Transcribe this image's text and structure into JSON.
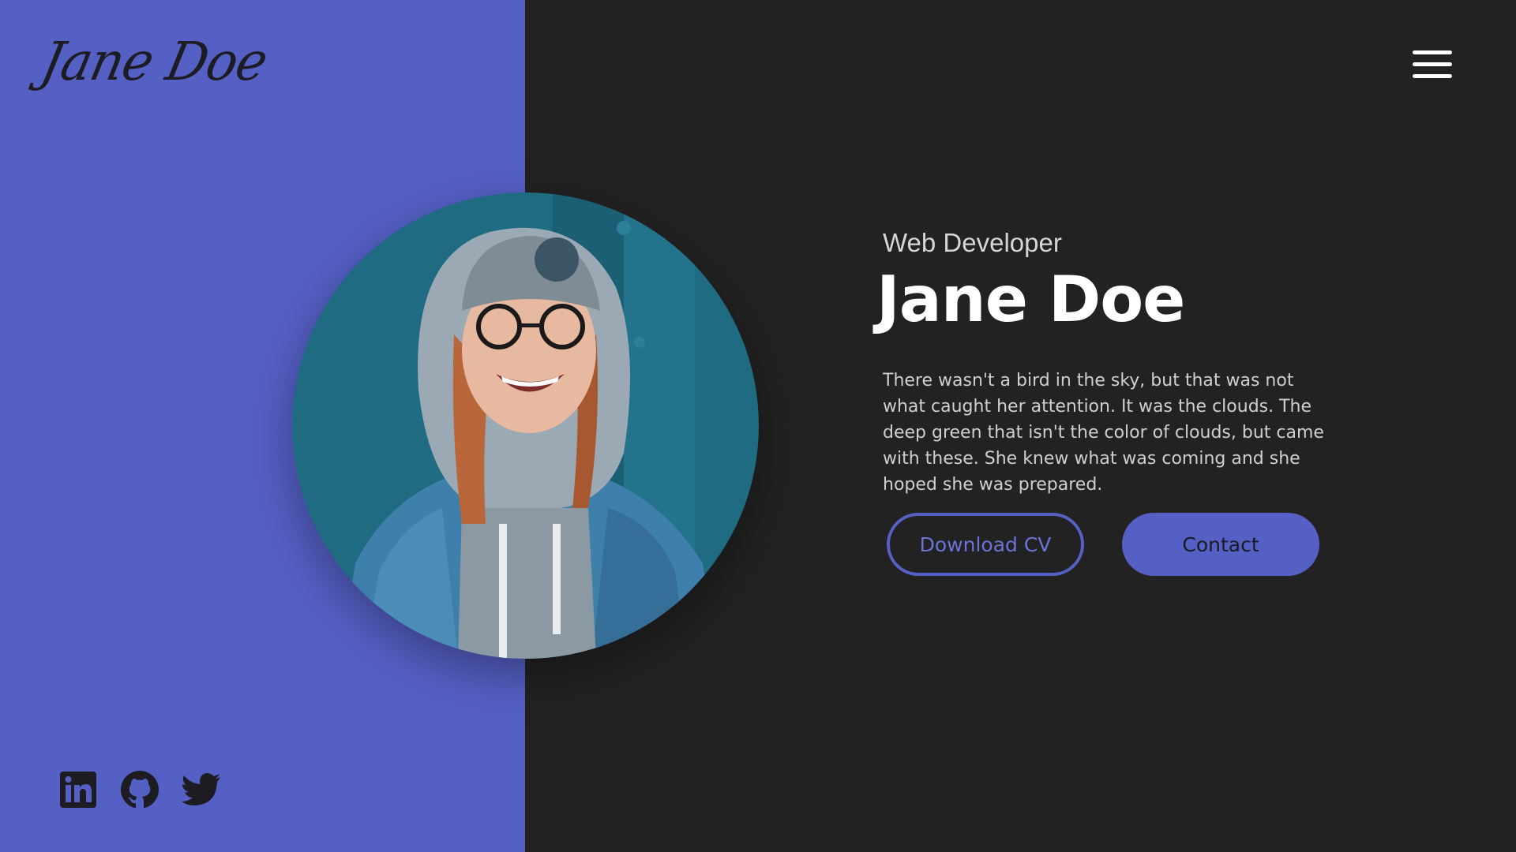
{
  "brand": {
    "logo_text": "Jane Doe"
  },
  "nav": {
    "menu_icon": "hamburger-menu-icon"
  },
  "hero": {
    "subtitle": "Web Developer",
    "name": "Jane Doe",
    "bio": "There wasn't a bird in the sky, but that was not what caught her attention. It was the clouds. The deep green that isn't the color of clouds, but came with these. She knew what was coming and she hoped she was prepared.",
    "download_label": "Download CV",
    "contact_label": "Contact"
  },
  "socials": [
    {
      "icon": "linkedin-icon"
    },
    {
      "icon": "github-icon"
    },
    {
      "icon": "twitter-icon"
    }
  ],
  "colors": {
    "accent": "#5560c5",
    "background": "#222222",
    "text": "#ffffff"
  }
}
